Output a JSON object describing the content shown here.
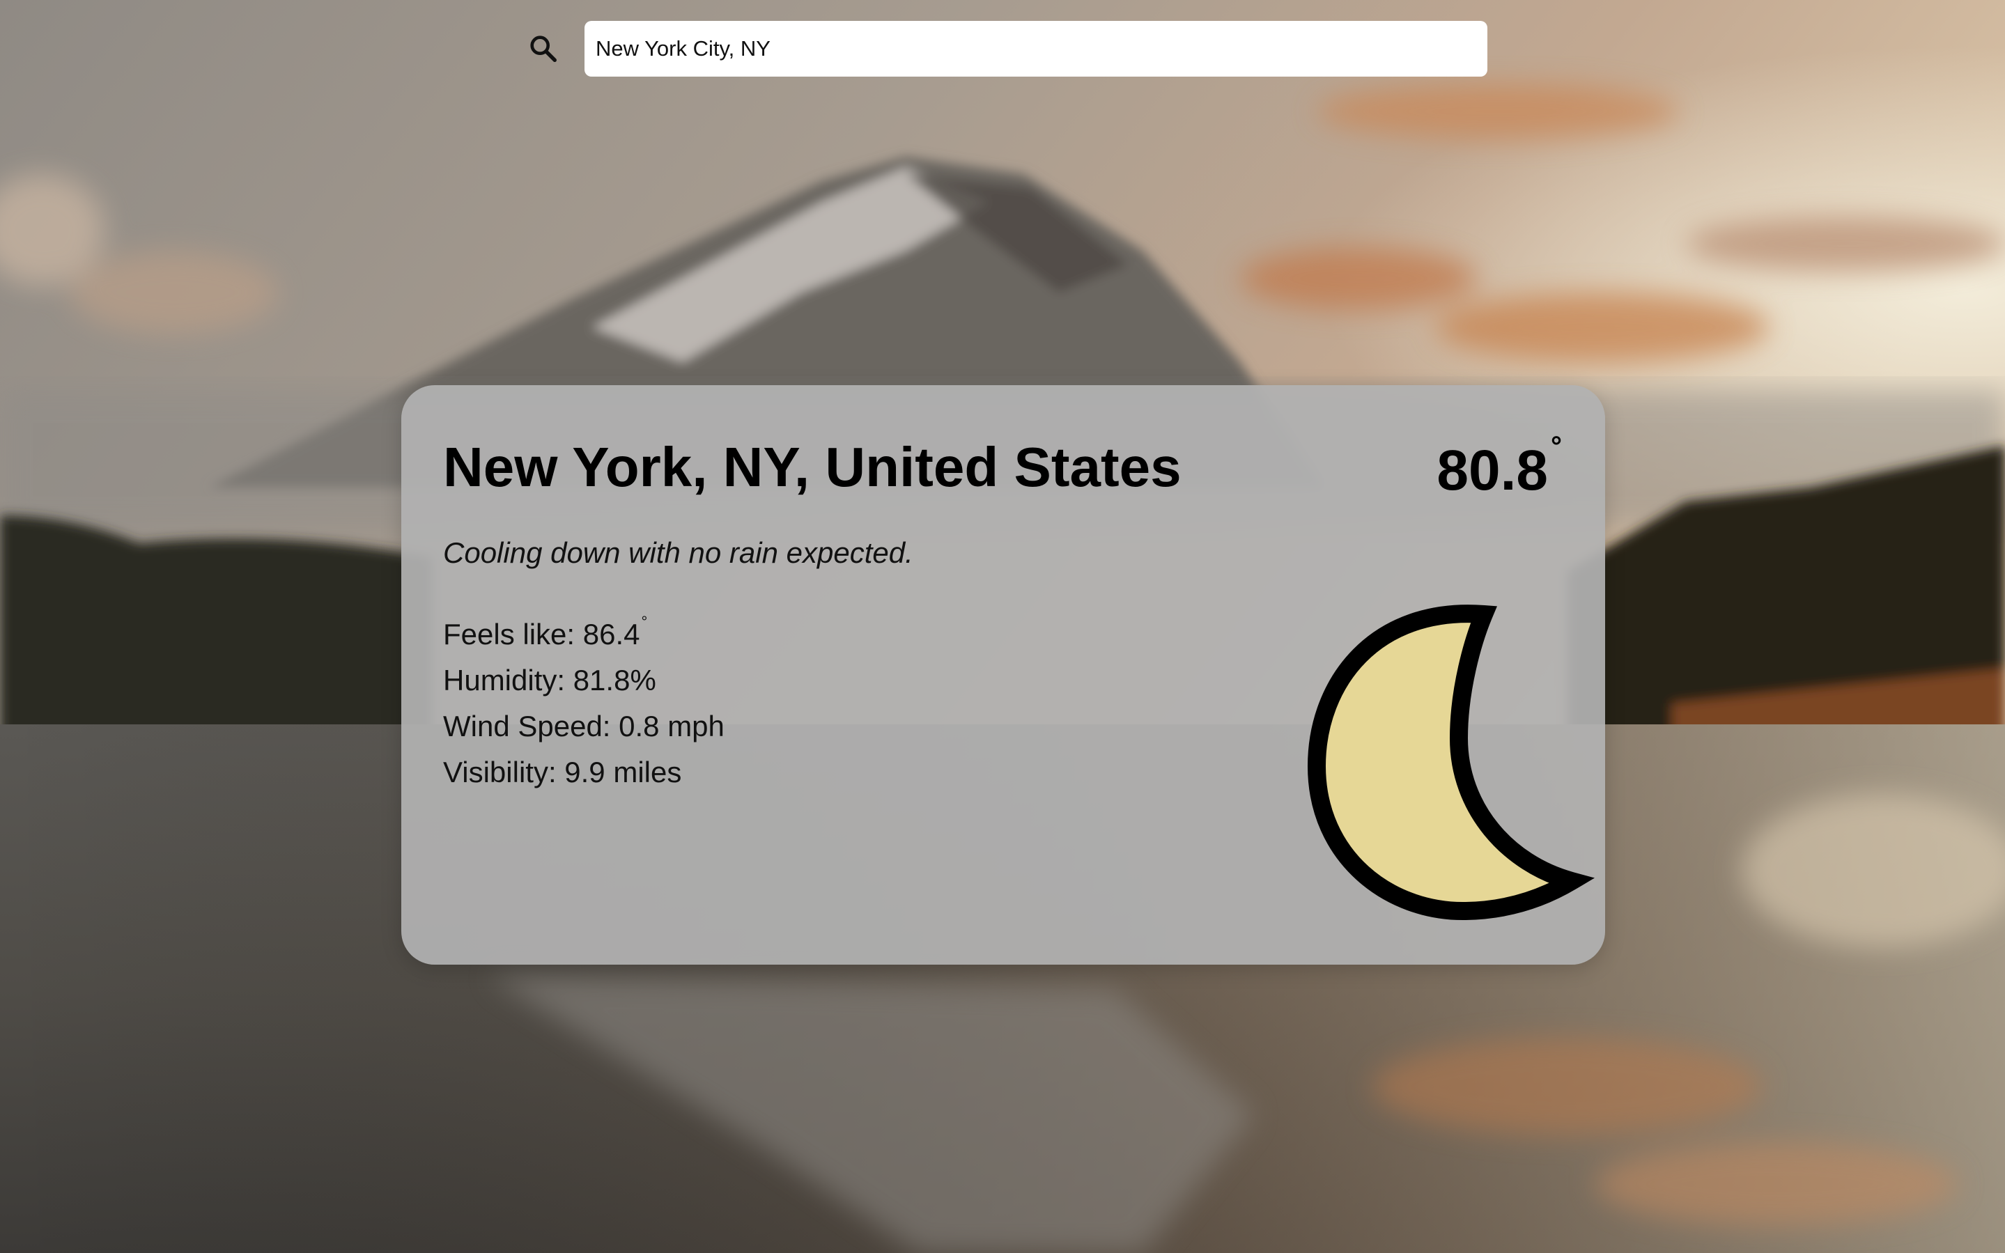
{
  "search": {
    "value": "New York City, NY",
    "icon": "search-icon"
  },
  "weather": {
    "location": "New York, NY, United States",
    "temperature": "80.8",
    "degree_symbol": "°",
    "description": "Cooling down with no rain expected.",
    "feels_like_label": "Feels like: ",
    "feels_like_value": "86.4",
    "humidity": "Humidity: 81.8%",
    "wind_speed": "Wind Speed: 0.8 mph",
    "visibility": "Visibility: 9.9 miles",
    "condition_icon": "moon-icon"
  },
  "colors": {
    "card_background": "#b2b2b2",
    "moon_fill": "#e6d796",
    "moon_outline": "#000000",
    "search_background": "#ffffff"
  }
}
